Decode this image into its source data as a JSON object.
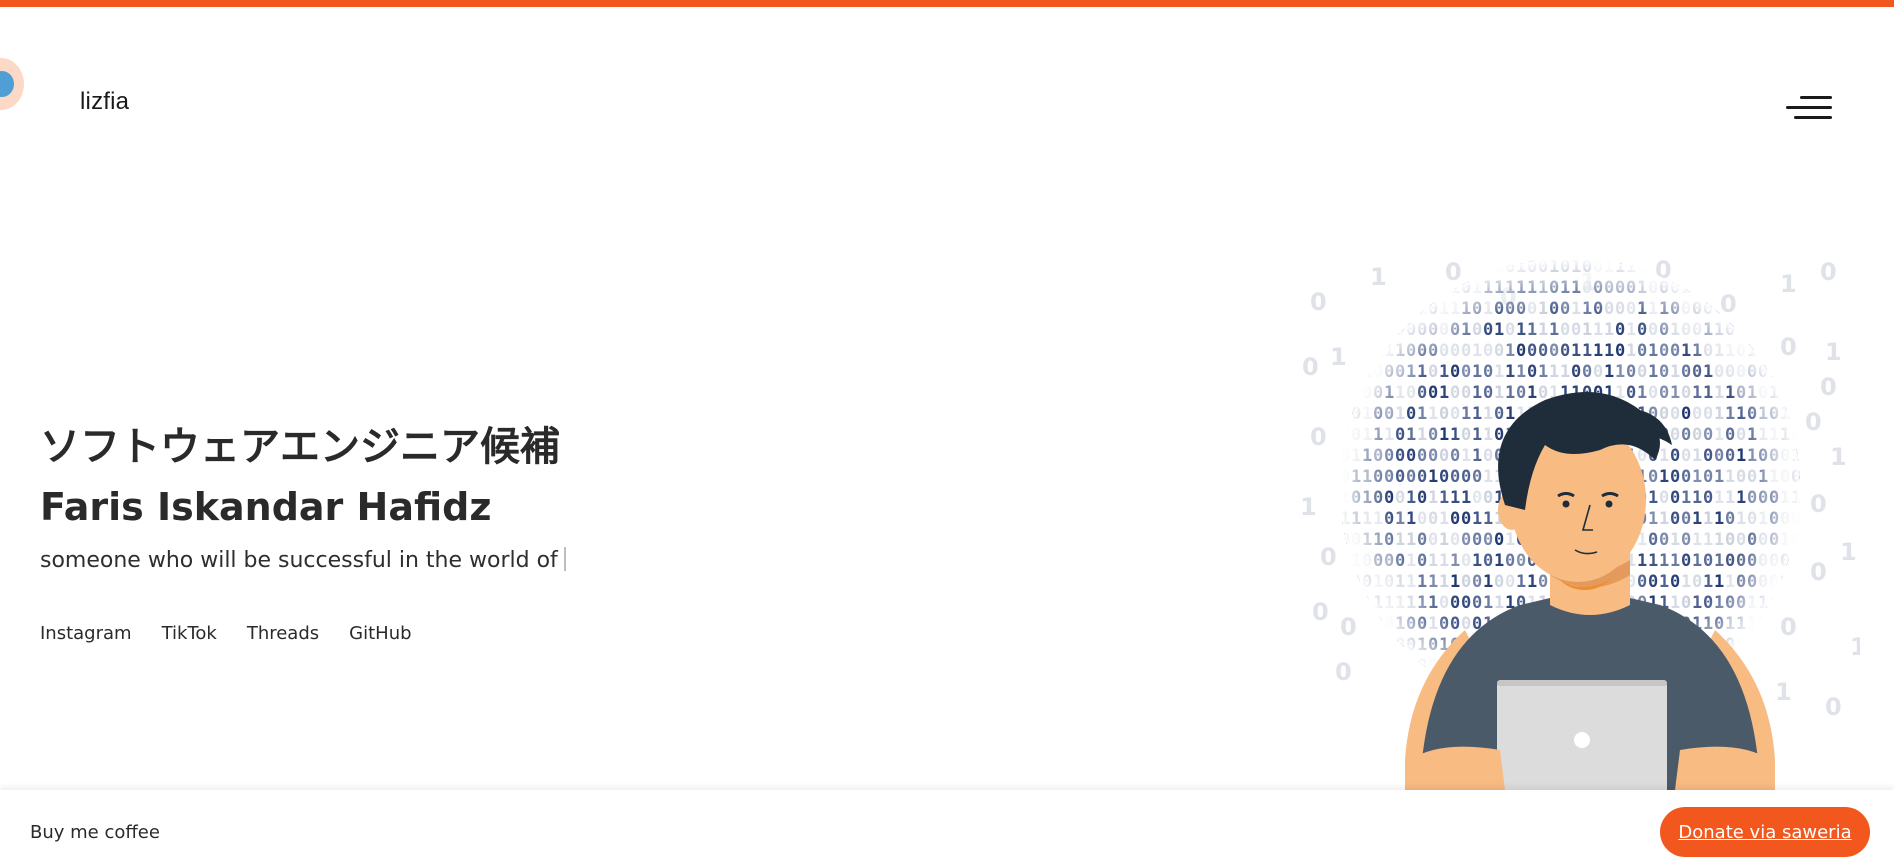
{
  "header": {
    "brand": "lizfia",
    "menu_icon": "hamburger-menu-icon"
  },
  "hero": {
    "title_jp": "ソフトウェアエンジニア候補",
    "name": "Faris Iskandar Hafidz",
    "tagline": "someone who will be successful in the world of"
  },
  "social": {
    "links": [
      "Instagram",
      "TikTok",
      "Threads",
      "GitHub"
    ]
  },
  "footer": {
    "label": "Buy me coffee",
    "donate_label": "Donate via saweria"
  },
  "colors": {
    "accent": "#f2581d",
    "text": "#2a2a2a",
    "binary_dark": "#1e3670",
    "binary_light": "#c9cfdc",
    "skin": "#f8bb82",
    "shirt": "#4a5a68",
    "hair": "#1f2d3a",
    "laptop": "#dcdcdc"
  },
  "illustration": {
    "icon": "developer-with-laptop-illustration"
  }
}
